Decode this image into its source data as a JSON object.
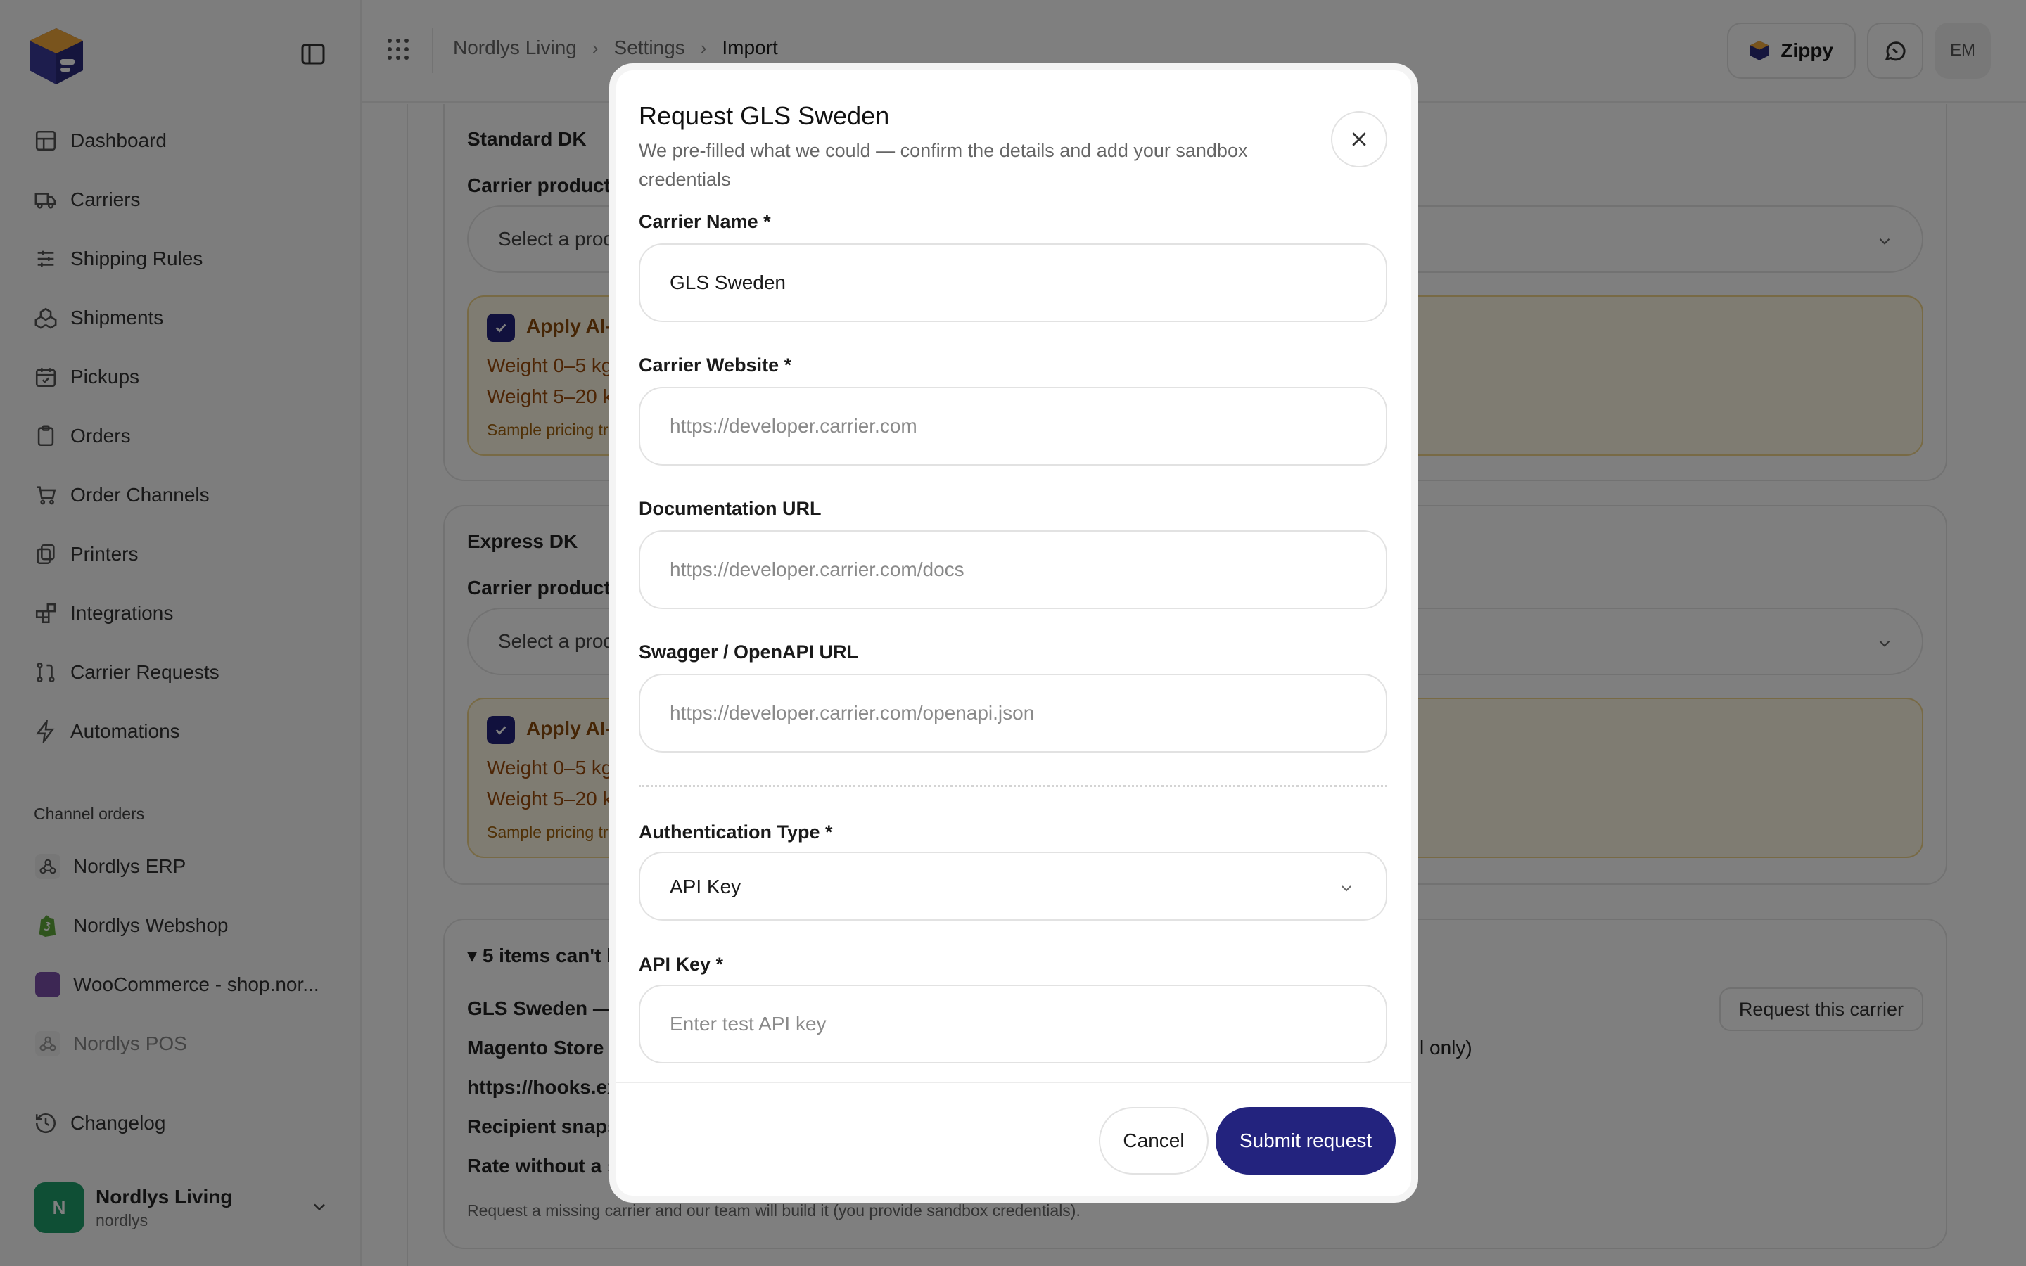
{
  "sidebar": {
    "nav": [
      {
        "label": "Dashboard",
        "icon": "dashboard-icon"
      },
      {
        "label": "Carriers",
        "icon": "truck-icon"
      },
      {
        "label": "Shipping Rules",
        "icon": "sliders-icon"
      },
      {
        "label": "Shipments",
        "icon": "boxes-icon"
      },
      {
        "label": "Pickups",
        "icon": "calendar-icon"
      },
      {
        "label": "Orders",
        "icon": "clipboard-icon"
      },
      {
        "label": "Order Channels",
        "icon": "cart-icon"
      },
      {
        "label": "Printers",
        "icon": "printer-icon"
      },
      {
        "label": "Integrations",
        "icon": "blocks-icon"
      },
      {
        "label": "Carrier Requests",
        "icon": "git-pull-icon"
      },
      {
        "label": "Automations",
        "icon": "zap-icon"
      }
    ],
    "section_label": "Channel orders",
    "channels": [
      {
        "label": "Nordlys ERP",
        "icon": "webhook-icon"
      },
      {
        "label": "Nordlys Webshop",
        "icon": "shopify-icon"
      },
      {
        "label": "WooCommerce - shop.nor...",
        "icon": "woocommerce-icon"
      },
      {
        "label": "Nordlys POS",
        "icon": "webhook-icon"
      }
    ],
    "changelog": "Changelog",
    "account": {
      "initial": "N",
      "name": "Nordlys Living",
      "handle": "nordlys"
    }
  },
  "topbar": {
    "breadcrumbs": [
      "Nordlys Living",
      "Settings",
      "Import"
    ],
    "assistant": "Zippy",
    "user_initials": "EM"
  },
  "background": {
    "card1": {
      "title": "Standard DK",
      "product_label": "Carrier product",
      "product_value": "Select a prod",
      "ai_heading": "Apply AI-t",
      "weight_1": "Weight 0–5 kg",
      "weight_2": "Weight 5–20 k",
      "sample": "Sample pricing tr"
    },
    "card2": {
      "title": "Express DK",
      "product_label": "Carrier product",
      "product_value": "Select a prod",
      "ai_heading": "Apply AI-t",
      "weight_1": "Weight 0–5 kg",
      "weight_2": "Weight 5–20 k",
      "sample": "Sample pricing tr"
    },
    "card3": {
      "summary": "▾ 5 items can't b",
      "row1": "GLS Sweden —",
      "request_button": "Request this carrier",
      "row2": "Magento Store -",
      "row2_tail": "l only)",
      "row3": "https://hooks.ex",
      "row4": "Recipient snaps",
      "row5": "Rate without a s",
      "footnote": "Request a missing carrier and our team will build it (you provide sandbox credentials)."
    }
  },
  "modal": {
    "title": "Request GLS Sweden",
    "subtitle": "We pre-filled what we could — confirm the details and add your sandbox credentials",
    "fields": {
      "carrier_name": {
        "label": "Carrier Name *",
        "value": "GLS Sweden"
      },
      "carrier_website": {
        "label": "Carrier Website *",
        "placeholder": "https://developer.carrier.com"
      },
      "documentation_url": {
        "label": "Documentation URL",
        "placeholder": "https://developer.carrier.com/docs"
      },
      "swagger_url": {
        "label": "Swagger / OpenAPI URL",
        "placeholder": "https://developer.carrier.com/openapi.json"
      },
      "auth_type": {
        "label": "Authentication Type *",
        "value": "API Key"
      },
      "api_key": {
        "label": "API Key *",
        "placeholder": "Enter test API key"
      }
    },
    "cancel": "Cancel",
    "submit": "Submit request"
  },
  "colors": {
    "accent": "#23237e",
    "avatar": "#1f9e6b",
    "ai_bg": "#fff8e4",
    "ai_text": "#9a4a0a"
  }
}
